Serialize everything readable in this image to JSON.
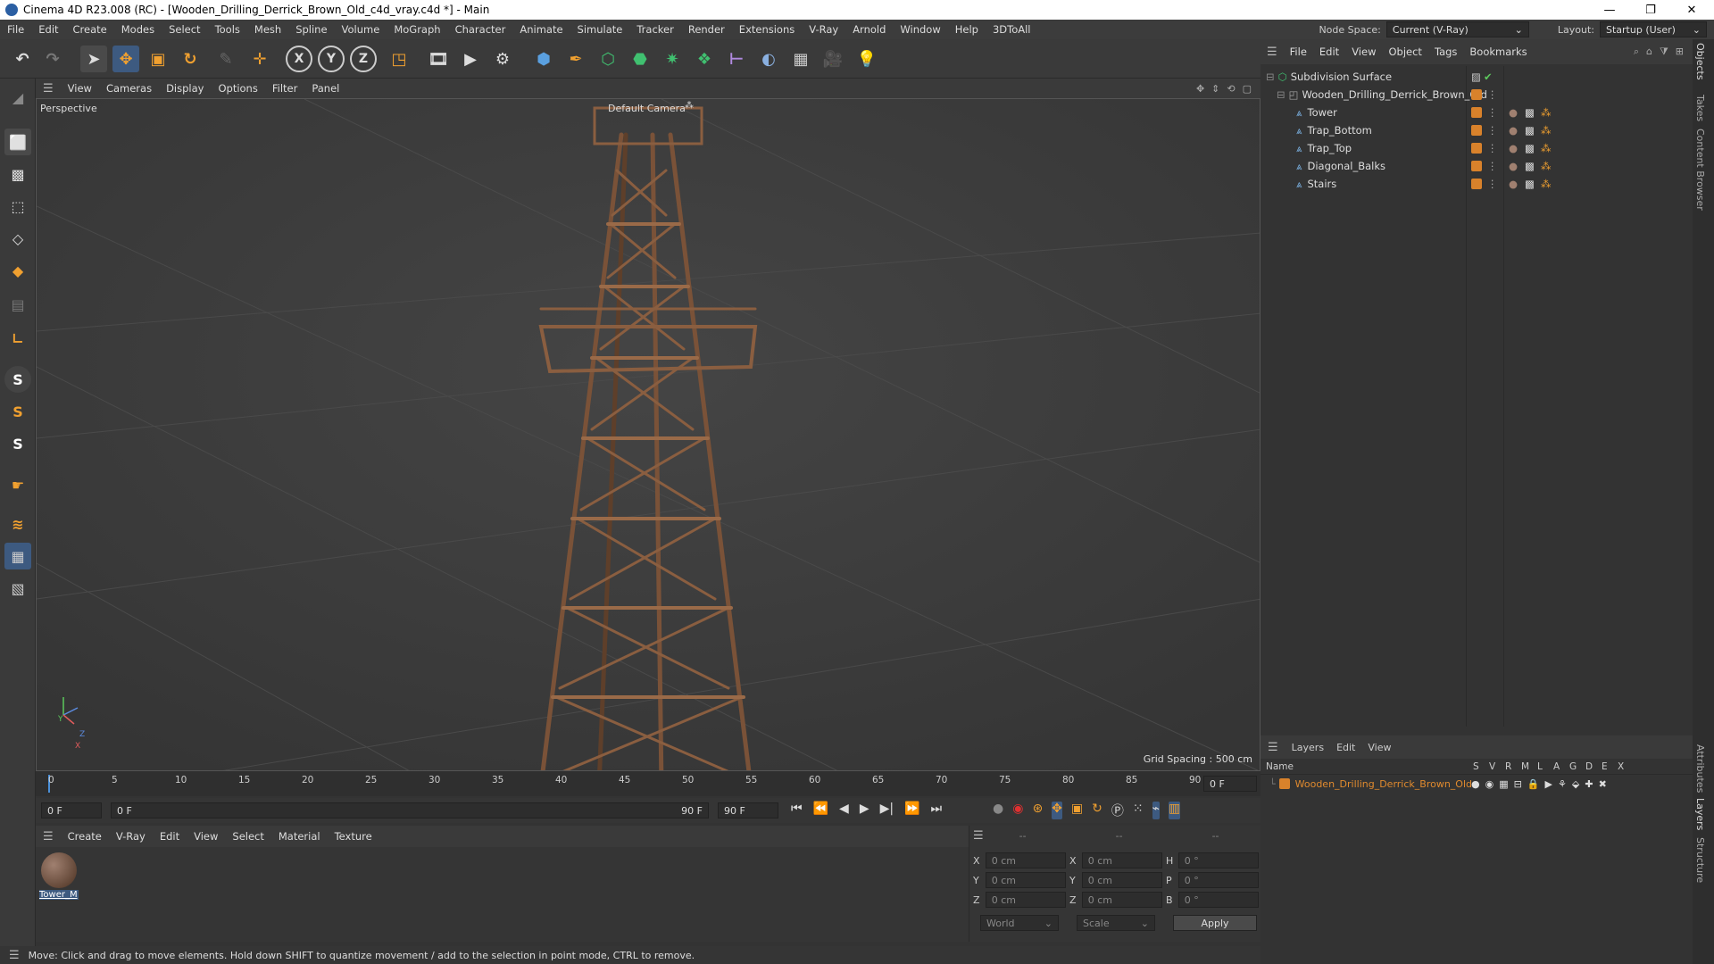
{
  "window": {
    "title": "Cinema 4D R23.008 (RC) - [Wooden_Drilling_Derrick_Brown_Old_c4d_vray.c4d *] - Main",
    "controls": [
      "—",
      "❐",
      "✕"
    ]
  },
  "menubar": {
    "items": [
      "File",
      "Edit",
      "Create",
      "Modes",
      "Select",
      "Tools",
      "Mesh",
      "Spline",
      "Volume",
      "MoGraph",
      "Character",
      "Animate",
      "Simulate",
      "Tracker",
      "Render",
      "Extensions",
      "V-Ray",
      "Arnold",
      "Window",
      "Help",
      "3DToAll"
    ],
    "node_space_label": "Node Space:",
    "node_space_value": "Current (V-Ray)",
    "layout_label": "Layout:",
    "layout_value": "Startup (User)"
  },
  "viewport_menu": {
    "items": [
      "View",
      "Cameras",
      "Display",
      "Options",
      "Filter",
      "Panel"
    ]
  },
  "viewport": {
    "view_name": "Perspective",
    "camera_label": "Default Camera",
    "grid_spacing": "Grid Spacing : 500 cm",
    "axis": {
      "y": "Y",
      "z": "Z",
      "x": "X"
    }
  },
  "timeline": {
    "ticks": [
      "0",
      "5",
      "10",
      "15",
      "20",
      "25",
      "30",
      "35",
      "40",
      "45",
      "50",
      "55",
      "60",
      "65",
      "70",
      "75",
      "80",
      "85",
      "90"
    ],
    "current_frame": "0 F"
  },
  "transport": {
    "start_frame": "0 F",
    "range_start": "0 F",
    "range_end": "90 F",
    "end_frame": "90 F"
  },
  "material_menu": {
    "items": [
      "Create",
      "V-Ray",
      "Edit",
      "View",
      "Select",
      "Material",
      "Texture"
    ]
  },
  "materials": [
    {
      "name": "Tower_M"
    }
  ],
  "attributes": {
    "header": [
      "--",
      "--",
      "--"
    ],
    "rows": [
      {
        "l1": "X",
        "v1": "0 cm",
        "l2": "X",
        "v2": "0 cm",
        "l3": "H",
        "v3": "0 °"
      },
      {
        "l1": "Y",
        "v1": "0 cm",
        "l2": "Y",
        "v2": "0 cm",
        "l3": "P",
        "v3": "0 °"
      },
      {
        "l1": "Z",
        "v1": "0 cm",
        "l2": "Z",
        "v2": "0 cm",
        "l3": "B",
        "v3": "0 °"
      }
    ],
    "coord_mode": "World",
    "scale_mode": "Scale",
    "apply_label": "Apply"
  },
  "status": {
    "text": "Move: Click and drag to move elements. Hold down SHIFT to quantize movement / add to the selection in point mode, CTRL to remove."
  },
  "object_menu": {
    "items": [
      "File",
      "Edit",
      "View",
      "Object",
      "Tags",
      "Bookmarks"
    ]
  },
  "objects": [
    {
      "name": "Subdivision Surface",
      "level": 0
    },
    {
      "name": "Wooden_Drilling_Derrick_Brown_Old",
      "level": 1
    },
    {
      "name": "Tower",
      "level": 2
    },
    {
      "name": "Trap_Bottom",
      "level": 2
    },
    {
      "name": "Trap_Top",
      "level": 2
    },
    {
      "name": "Diagonal_Balks",
      "level": 2
    },
    {
      "name": "Stairs",
      "level": 2
    }
  ],
  "layers_menu": {
    "items": [
      "Layers",
      "Edit",
      "View"
    ]
  },
  "layers": {
    "columns": [
      "Name",
      "S",
      "V",
      "R",
      "M",
      "L",
      "A",
      "G",
      "D",
      "E",
      "X"
    ],
    "rows": [
      {
        "name": "Wooden_Drilling_Derrick_Brown_Old"
      }
    ]
  },
  "side_tabs": [
    "Objects",
    "Takes",
    "Content Browser",
    "Attributes",
    "Layers",
    "Structure"
  ],
  "colors": {
    "accent_orange": "#e08a2e",
    "layer_orange": "#d9822b",
    "highlight_blue": "#4a90d9",
    "wood": "#7a5238"
  }
}
